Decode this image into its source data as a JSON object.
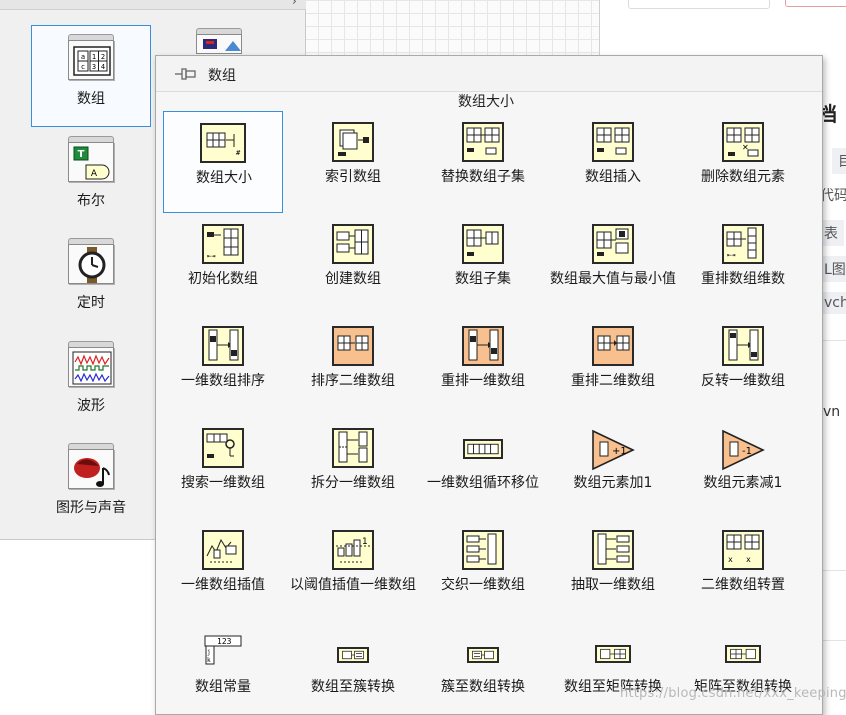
{
  "left_palette": {
    "items": [
      {
        "label": "数组",
        "icon": "array-folder-icon"
      },
      {
        "label": "布尔",
        "icon": "boolean-folder-icon"
      },
      {
        "label": "定时",
        "icon": "timing-folder-icon"
      },
      {
        "label": "波形",
        "icon": "waveform-folder-icon"
      },
      {
        "label": "图形与声音",
        "icon": "graphics-sound-folder-icon"
      }
    ]
  },
  "sub_palette": {
    "title": "数组",
    "hover_label": "数组大小",
    "items": [
      {
        "label": "数组大小",
        "icon": "array-size-icon"
      },
      {
        "label": "索引数组",
        "icon": "index-array-icon"
      },
      {
        "label": "替换数组子集",
        "icon": "replace-subset-icon"
      },
      {
        "label": "数组插入",
        "icon": "insert-into-array-icon"
      },
      {
        "label": "删除数组元素",
        "icon": "delete-from-array-icon"
      },
      {
        "label": "初始化数组",
        "icon": "initialize-array-icon"
      },
      {
        "label": "创建数组",
        "icon": "build-array-icon"
      },
      {
        "label": "数组子集",
        "icon": "array-subset-icon"
      },
      {
        "label": "数组最大值与最小值",
        "icon": "array-max-min-icon"
      },
      {
        "label": "重排数组维数",
        "icon": "reshape-array-icon"
      },
      {
        "label": "一维数组排序",
        "icon": "sort-1d-array-icon"
      },
      {
        "label": "排序二维数组",
        "icon": "sort-2d-array-icon"
      },
      {
        "label": "重排一维数组",
        "icon": "shuffle-1d-array-icon"
      },
      {
        "label": "重排二维数组",
        "icon": "shuffle-2d-array-icon"
      },
      {
        "label": "反转一维数组",
        "icon": "reverse-1d-array-icon"
      },
      {
        "label": "搜索一维数组",
        "icon": "search-1d-array-icon"
      },
      {
        "label": "拆分一维数组",
        "icon": "split-1d-array-icon"
      },
      {
        "label": "一维数组循环移位",
        "icon": "rotate-1d-array-icon"
      },
      {
        "label": "数组元素加1",
        "icon": "increment-array-element-icon"
      },
      {
        "label": "数组元素减1",
        "icon": "decrement-array-element-icon"
      },
      {
        "label": "一维数组插值",
        "icon": "interpolate-1d-array-icon"
      },
      {
        "label": "以阈值插值一维数组",
        "icon": "threshold-1d-array-icon"
      },
      {
        "label": "交织一维数组",
        "icon": "interleave-1d-arrays-icon"
      },
      {
        "label": "抽取一维数组",
        "icon": "decimate-1d-array-icon"
      },
      {
        "label": "二维数组转置",
        "icon": "transpose-2d-array-icon"
      },
      {
        "label": "数组常量",
        "icon": "array-constant-icon"
      },
      {
        "label": "数组至簇转换",
        "icon": "array-to-cluster-icon"
      },
      {
        "label": "簇至数组转换",
        "icon": "cluster-to-array-icon"
      },
      {
        "label": "数组至矩阵转换",
        "icon": "array-to-matrix-icon"
      },
      {
        "label": "矩阵至数组转换",
        "icon": "matrix-to-array-icon"
      }
    ]
  },
  "background_fragments": {
    "title": "档",
    "frag1": "代码",
    "frag2": "表",
    "frag3": "L图",
    "frag4": "vch",
    "frag5": "vn",
    "frag6": "目"
  },
  "watermark": "https://blog.csdn.net/xxx_keeping",
  "colors": {
    "selection_border": "#3b8edb",
    "vi_yellow": "#fefecf",
    "vi_orange": "#f7c08e"
  }
}
